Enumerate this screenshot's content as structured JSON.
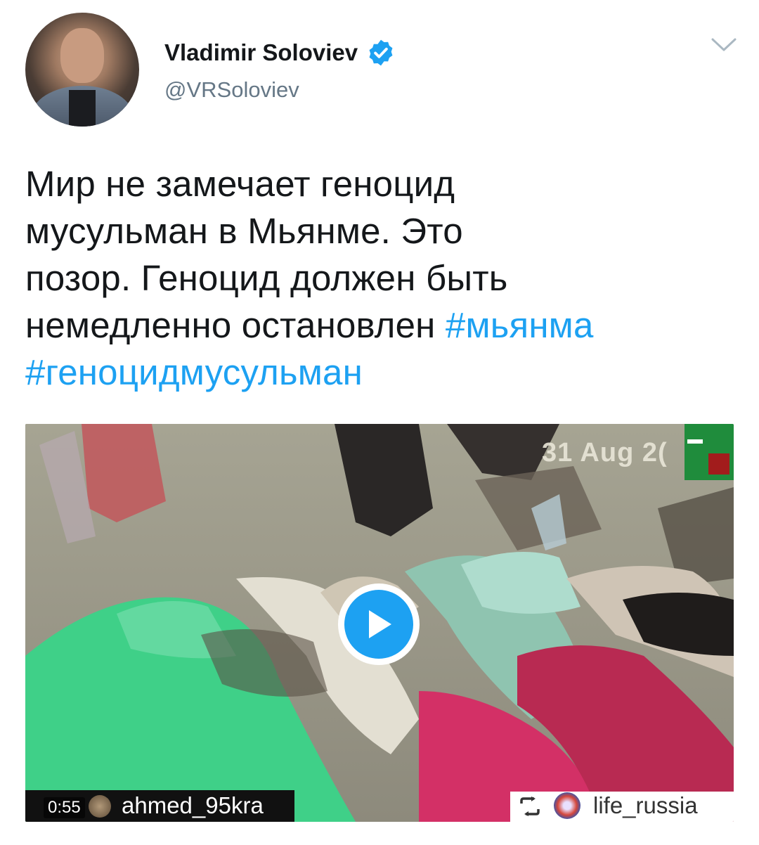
{
  "tweet": {
    "author_name": "Vladimir Soloviev",
    "handle": "@VRSoloviev",
    "text_lines": [
      "Мир не замечает геноцид",
      "мусульман в Мьянме. Это",
      "позор. Геноцид должен быть",
      "немедленно остановлен "
    ],
    "hashtags": [
      "#мьянма",
      "#геноцидмусульман"
    ]
  },
  "video": {
    "duration": "0:55",
    "date_overlay": "31 Aug 2(",
    "left_overlay_user": "ahmed_95kra",
    "right_overlay_user": "life_russia"
  },
  "colors": {
    "accent": "#1da1f2",
    "text": "#14171a",
    "secondary": "#657786"
  },
  "icons": [
    "verified-icon",
    "chevron-down-icon",
    "play-icon",
    "repost-icon"
  ]
}
